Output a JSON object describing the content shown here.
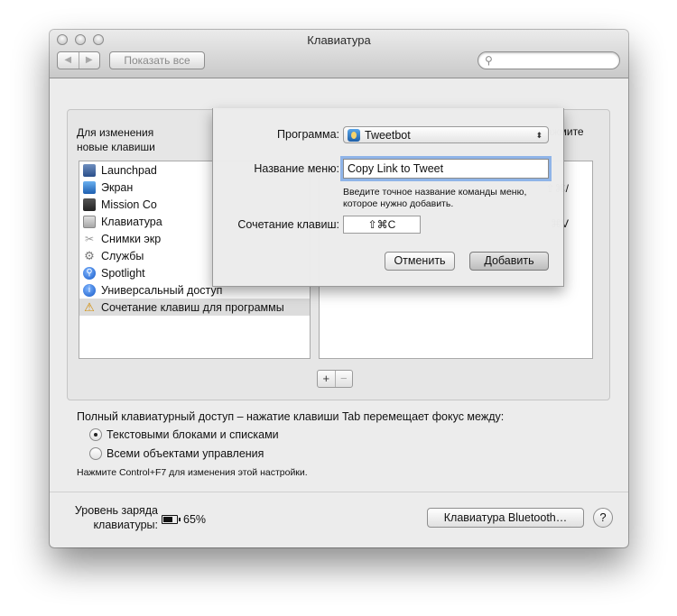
{
  "window": {
    "title": "Клавиатура",
    "nav_back": "◀",
    "nav_forward": "▶",
    "show_all": "Показать все",
    "search_placeholder": ""
  },
  "instructions": {
    "left": "Для изменения",
    "left_line2": "новые клавиши",
    "right": "ва и нажмите"
  },
  "categories": [
    {
      "label": "Launchpad",
      "icon": "launchpad-icon"
    },
    {
      "label": "Экран",
      "icon": "display-icon"
    },
    {
      "label": "Mission Co",
      "icon": "mission-control-icon"
    },
    {
      "label": "Клавиатура",
      "icon": "keyboard-icon"
    },
    {
      "label": "Снимки экр",
      "icon": "screenshot-icon"
    },
    {
      "label": "Службы",
      "icon": "services-gear-icon"
    },
    {
      "label": "Spotlight",
      "icon": "spotlight-icon"
    },
    {
      "label": "Универсальный доступ",
      "icon": "accessibility-icon"
    },
    {
      "label": "Сочетание клавиш для программы",
      "icon": "app-shortcuts-icon",
      "selected": true
    }
  ],
  "shortcuts": [
    "⇧⌘/",
    "⌘V"
  ],
  "list_buttons": {
    "add": "+",
    "remove": "−"
  },
  "full_access": {
    "label": "Полный клавиатурный доступ – нажатие клавиши Tab перемещает фокус между:",
    "option_text_boxes": "Текстовыми блоками и списками",
    "option_all_controls": "Всеми объектами управления",
    "selected": "text_boxes",
    "hint": "Нажмите Control+F7 для изменения этой настройки."
  },
  "battery": {
    "label_line1": "Уровень заряда",
    "label_line2": "клавиатуры:",
    "percent": "65%",
    "level": 0.65
  },
  "bluetooth_button": "Клавиатура Bluetooth…",
  "help_button": "?",
  "sheet": {
    "program_label": "Программа:",
    "program_value": "Tweetbot",
    "menu_label": "Название меню:",
    "menu_value": "Copy Link to Tweet",
    "menu_hint": "Введите точное название команды меню, которое нужно добавить.",
    "shortcut_label": "Сочетание клавиш:",
    "shortcut_value": "⇧⌘C",
    "cancel": "Отменить",
    "add": "Добавить"
  }
}
